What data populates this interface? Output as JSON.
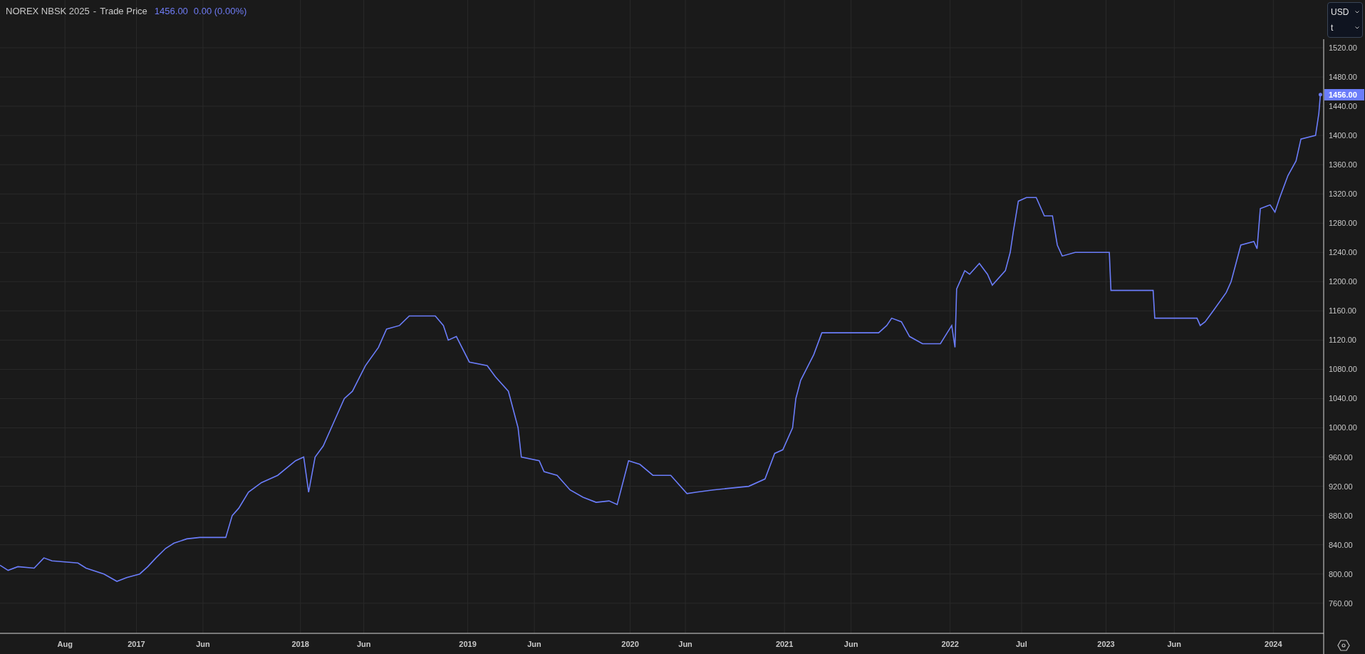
{
  "header": {
    "symbol": "NOREX NBSK 2025",
    "separator": "-",
    "price": "1456.00",
    "change": "0.00 (0.00%)"
  },
  "selectors": [
    {
      "value": "USD"
    },
    {
      "value": "t"
    }
  ],
  "last_price_label": "1456.00",
  "chart_data": {
    "type": "line",
    "grid": true,
    "xlim": [
      2016.16,
      2024.31
    ],
    "ylim": [
      718.8,
      1585.3
    ],
    "x": [
      2016.16,
      2016.21,
      2016.27,
      2016.37,
      2016.43,
      2016.48,
      2016.64,
      2016.69,
      2016.8,
      2016.88,
      2016.94,
      2017.02,
      2017.07,
      2017.12,
      2017.18,
      2017.23,
      2017.31,
      2017.39,
      2017.55,
      2017.59,
      2017.63,
      2017.69,
      2017.77,
      2017.87,
      2017.98,
      2018.03,
      2018.06,
      2018.1,
      2018.15,
      2018.22,
      2018.28,
      2018.33,
      2018.41,
      2018.49,
      2018.54,
      2018.62,
      2018.68,
      2018.84,
      2018.89,
      2018.92,
      2018.97,
      2019.05,
      2019.16,
      2019.21,
      2019.29,
      2019.35,
      2019.37,
      2019.48,
      2019.51,
      2019.59,
      2019.67,
      2019.75,
      2019.83,
      2019.91,
      2019.96,
      2020.03,
      2020.1,
      2020.18,
      2020.29,
      2020.39,
      2020.45,
      2020.55,
      2020.77,
      2020.87,
      2020.93,
      2020.98,
      2021.04,
      2021.06,
      2021.09,
      2021.17,
      2021.22,
      2021.57,
      2021.62,
      2021.65,
      2021.71,
      2021.76,
      2021.84,
      2021.95,
      2022.02,
      2022.04,
      2022.05,
      2022.1,
      2022.13,
      2022.19,
      2022.24,
      2022.27,
      2022.35,
      2022.38,
      2022.4,
      2022.43,
      2022.48,
      2022.54,
      2022.59,
      2022.64,
      2022.67,
      2022.7,
      2022.78,
      2022.91,
      2022.99,
      2023.0,
      2023.26,
      2023.27,
      2023.53,
      2023.55,
      2023.58,
      2023.63,
      2023.71,
      2023.74,
      2023.77,
      2023.8,
      2023.88,
      2023.9,
      2023.92,
      2023.98,
      2024.01,
      2024.04,
      2024.09,
      2024.14,
      2024.17,
      2024.26,
      2024.28,
      2024.29
    ],
    "series": [
      {
        "name": "Trade Price",
        "color": "#6b7dfa",
        "values": [
          812,
          805,
          810,
          808,
          822,
          818,
          815,
          808,
          800,
          790,
          795,
          800,
          810,
          822,
          835,
          842,
          848,
          850,
          850,
          880,
          890,
          912,
          925,
          935,
          955,
          960,
          912,
          960,
          975,
          1010,
          1040,
          1050,
          1085,
          1110,
          1135,
          1140,
          1153,
          1153,
          1140,
          1120,
          1125,
          1090,
          1085,
          1070,
          1050,
          1000,
          960,
          955,
          940,
          935,
          915,
          905,
          898,
          900,
          895,
          955,
          950,
          935,
          935,
          910,
          912,
          915,
          920,
          930,
          965,
          970,
          1000,
          1040,
          1065,
          1100,
          1130,
          1130,
          1140,
          1150,
          1145,
          1125,
          1115,
          1115,
          1140,
          1110,
          1190,
          1215,
          1210,
          1225,
          1210,
          1195,
          1215,
          1240,
          1270,
          1310,
          1315,
          1315,
          1290,
          1290,
          1250,
          1235,
          1240,
          1240,
          1240,
          1188,
          1188,
          1150,
          1150,
          1140,
          1145,
          1160,
          1185,
          1200,
          1225,
          1250,
          1255,
          1245,
          1300,
          1305,
          1295,
          1315,
          1345,
          1365,
          1395,
          1400,
          1430,
          1456
        ]
      }
    ],
    "xticks": [
      {
        "value": 2016.56,
        "label": "Aug"
      },
      {
        "value": 2017,
        "label": "2017"
      },
      {
        "value": 2017.41,
        "label": "Jun"
      },
      {
        "value": 2018.01,
        "label": "2018"
      },
      {
        "value": 2018.4,
        "label": "Jun"
      },
      {
        "value": 2019.04,
        "label": "2019"
      },
      {
        "value": 2019.45,
        "label": "Jun"
      },
      {
        "value": 2020.04,
        "label": "2020"
      },
      {
        "value": 2020.38,
        "label": "Jun"
      },
      {
        "value": 2020.99,
        "label": "2021"
      },
      {
        "value": 2021.4,
        "label": "Jun"
      },
      {
        "value": 2022.01,
        "label": "2022"
      },
      {
        "value": 2022.45,
        "label": "Jul"
      },
      {
        "value": 2022.97,
        "label": "2023"
      },
      {
        "value": 2023.39,
        "label": "Jun"
      },
      {
        "value": 2024,
        "label": "2024"
      }
    ],
    "yticks": [
      {
        "value": 760,
        "label": "760.00"
      },
      {
        "value": 800,
        "label": "800.00"
      },
      {
        "value": 840,
        "label": "840.00"
      },
      {
        "value": 880,
        "label": "880.00"
      },
      {
        "value": 920,
        "label": "920.00"
      },
      {
        "value": 960,
        "label": "960.00"
      },
      {
        "value": 1000,
        "label": "1000.00"
      },
      {
        "value": 1040,
        "label": "1040.00"
      },
      {
        "value": 1080,
        "label": "1080.00"
      },
      {
        "value": 1120,
        "label": "1120.00"
      },
      {
        "value": 1160,
        "label": "1160.00"
      },
      {
        "value": 1200,
        "label": "1200.00"
      },
      {
        "value": 1240,
        "label": "1240.00"
      },
      {
        "value": 1280,
        "label": "1280.00"
      },
      {
        "value": 1320,
        "label": "1320.00"
      },
      {
        "value": 1360,
        "label": "1360.00"
      },
      {
        "value": 1400,
        "label": "1400.00"
      },
      {
        "value": 1440,
        "label": "1440.00"
      },
      {
        "value": 1480,
        "label": "1480.00"
      },
      {
        "value": 1520,
        "label": "1520.00"
      }
    ]
  }
}
